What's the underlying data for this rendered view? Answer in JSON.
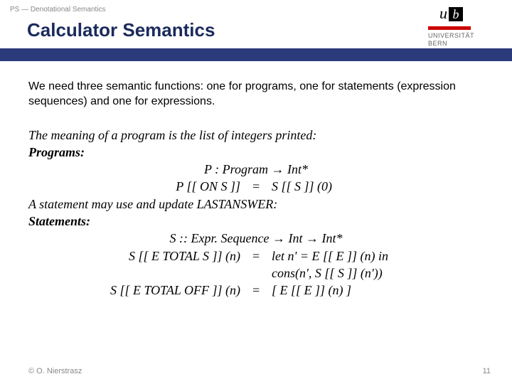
{
  "header": {
    "label": "PS — Denotational Semantics"
  },
  "logo": {
    "u": "u",
    "b": "b",
    "line1": "UNIVERSITÄT",
    "line2": "BERN"
  },
  "title": "Calculator Semantics",
  "intro": "We need three semantic functions: one for programs, one for statements (expression sequences) and one for expressions.",
  "sem": {
    "p_meaning": "The meaning of a program is the list of integers printed:",
    "p_label": "Programs:",
    "p_sig": "P : Program → Int*",
    "p_eq_l": "P [[ ON S ]]",
    "p_eq_m": "=",
    "p_eq_r": "S [[ S ]] (0)",
    "s_meaning": "A statement may use and update LASTANSWER:",
    "s_label": "Statements:",
    "s_sig": "S :: Expr. Sequence → Int → Int*",
    "s1_l": "S [[ E TOTAL S ]] (n)",
    "s1_m": "=",
    "s1_r1": "let n' = E [[ E ]] (n) in",
    "s1_r2": "cons(n', S [[ S ]] (n'))",
    "s2_l": "S [[ E TOTAL OFF ]] (n)",
    "s2_m": "=",
    "s2_r": "[ E [[ E ]] (n) ]"
  },
  "footer": {
    "copyright": "© O. Nierstrasz",
    "page": "11"
  }
}
